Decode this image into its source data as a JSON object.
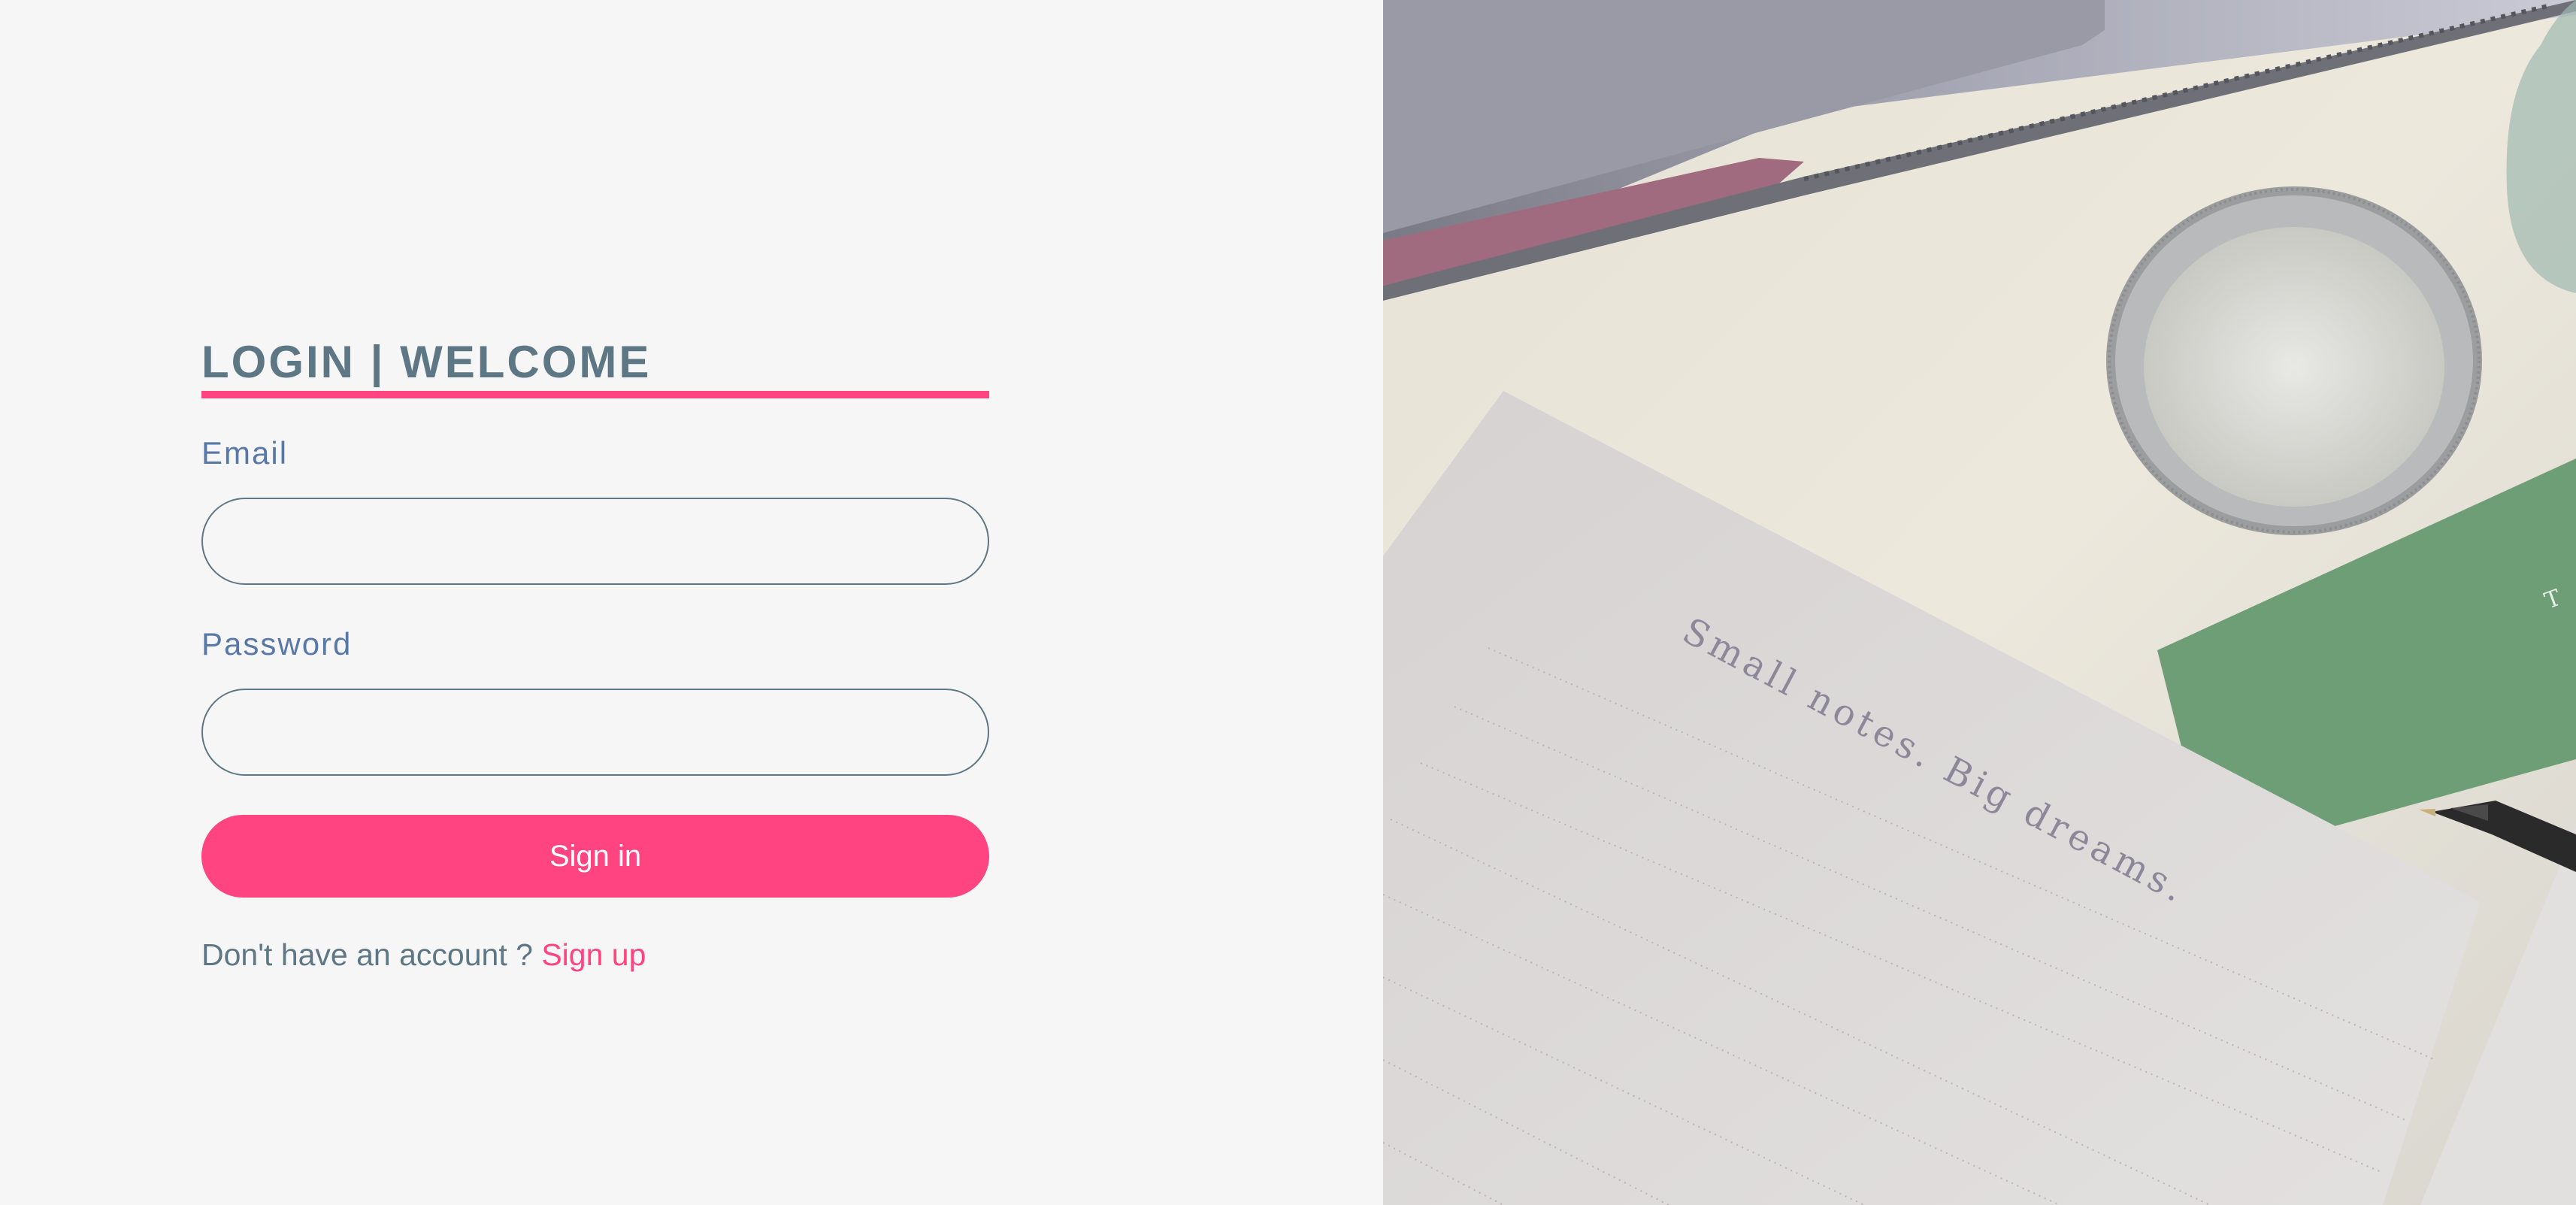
{
  "login": {
    "title": "LOGIN | WELCOME",
    "email_label": "Email",
    "email_value": "",
    "email_placeholder": "",
    "password_label": "Password",
    "password_value": "",
    "password_placeholder": "",
    "signin_label": "Sign in",
    "signup_prompt": "Don't have an account ? ",
    "signup_link": "Sign up"
  },
  "photo": {
    "note_text": "Small notes. Big dreams.",
    "card_text": "T"
  },
  "colors": {
    "accent": "#ff4481",
    "heading": "#5e7785",
    "label": "#5878a8",
    "background": "#f6f6f6"
  }
}
